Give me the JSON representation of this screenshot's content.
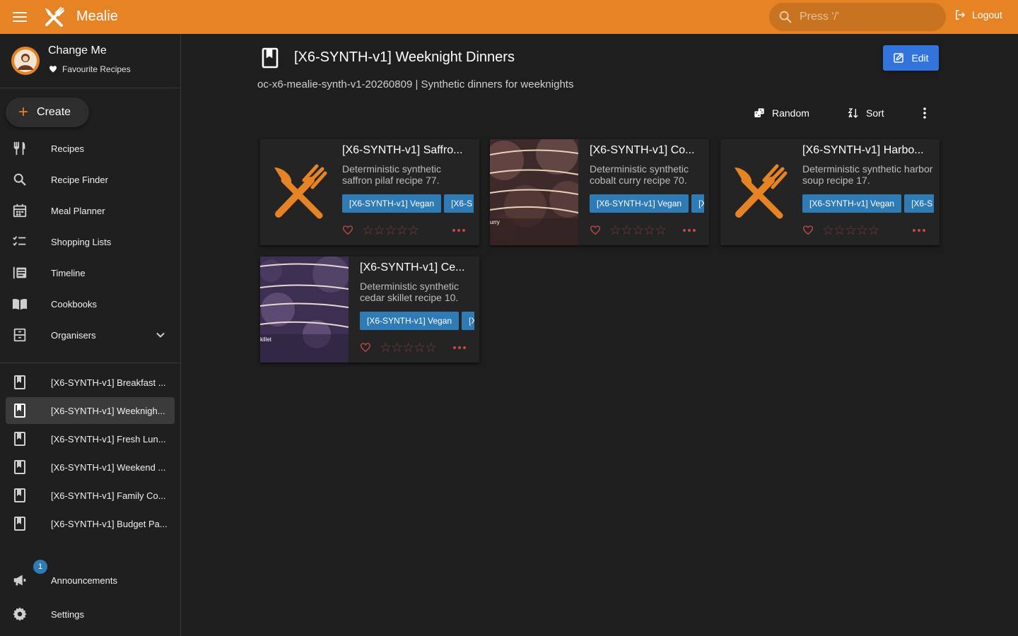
{
  "app": {
    "name": "Mealie"
  },
  "header": {
    "search_placeholder": "Press '/'",
    "logout_label": "Logout"
  },
  "user": {
    "name": "Change Me",
    "favourites_label": "Favourite Recipes"
  },
  "sidebar": {
    "create_label": "Create",
    "nav": [
      {
        "label": "Recipes",
        "icon": "fork-knife-icon"
      },
      {
        "label": "Recipe Finder",
        "icon": "search-icon"
      },
      {
        "label": "Meal Planner",
        "icon": "calendar-icon"
      },
      {
        "label": "Shopping Lists",
        "icon": "checklist-icon"
      },
      {
        "label": "Timeline",
        "icon": "timeline-icon"
      },
      {
        "label": "Cookbooks",
        "icon": "book-open-icon"
      },
      {
        "label": "Organisers",
        "icon": "archive-icon"
      }
    ],
    "cookbooks": [
      {
        "label": "[X6-SYNTH-v1] Breakfast ...",
        "active": false
      },
      {
        "label": "[X6-SYNTH-v1] Weeknigh...",
        "active": true
      },
      {
        "label": "[X6-SYNTH-v1] Fresh Lun...",
        "active": false
      },
      {
        "label": "[X6-SYNTH-v1] Weekend ...",
        "active": false
      },
      {
        "label": "[X6-SYNTH-v1] Family Co...",
        "active": false
      },
      {
        "label": "[X6-SYNTH-v1] Budget Pa...",
        "active": false
      }
    ],
    "announcements": {
      "label": "Announcements",
      "badge": "1"
    },
    "settings_label": "Settings"
  },
  "page": {
    "title": "[X6-SYNTH-v1] Weeknight Dinners",
    "description": "oc-x6-mealie-synth-v1-20260809 | Synthetic dinners for weeknights",
    "edit_label": "Edit",
    "random_label": "Random",
    "sort_label": "Sort"
  },
  "recipes": [
    {
      "title": "[X6-SYNTH-v1] Saffro...",
      "description": "Deterministic synthetic saffron pilaf recipe 77.",
      "tags": [
        "[X6-SYNTH-v1] Vegan",
        "[X6-S"
      ],
      "thumb": "placeholder",
      "rating": "☆☆☆☆☆"
    },
    {
      "title": "[X6-SYNTH-v1] Co...",
      "description": "Deterministic synthetic cobalt curry recipe 70.",
      "tags": [
        "[X6-SYNTH-v1] Vegan",
        "[X"
      ],
      "thumb": "image-brown",
      "thumb_caption": "urry",
      "rating": "☆☆☆☆☆"
    },
    {
      "title": "[X6-SYNTH-v1] Harbo...",
      "description": "Deterministic synthetic harbor soup recipe 17.",
      "tags": [
        "[X6-SYNTH-v1] Vegan",
        "[X6-S"
      ],
      "thumb": "placeholder",
      "rating": "☆☆☆☆☆"
    },
    {
      "title": "[X6-SYNTH-v1] Ce...",
      "description": "Deterministic synthetic cedar skillet recipe 10.",
      "tags": [
        "[X6-SYNTH-v1] Vegan",
        "[X"
      ],
      "thumb": "image-purple",
      "thumb_caption": "killet",
      "rating": "☆☆☆☆☆"
    }
  ],
  "colors": {
    "primary": "#E58325",
    "tag": "#2f7bb5",
    "edit_button": "#3273dc",
    "background": "#1e1e1e"
  }
}
